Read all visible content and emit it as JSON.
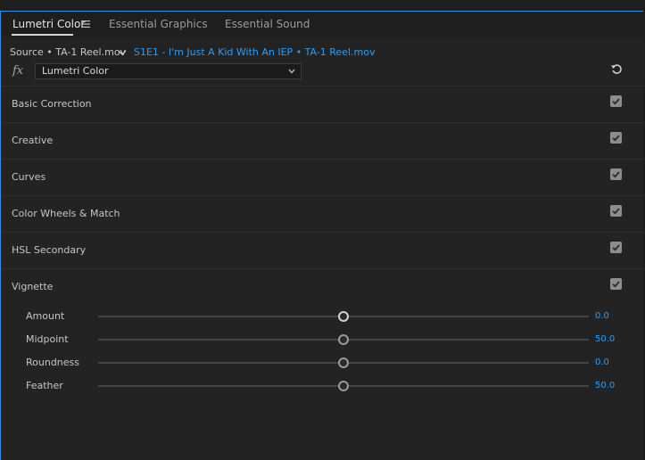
{
  "tabs": [
    {
      "label": "Lumetri Color"
    },
    {
      "label": "Essential Graphics"
    },
    {
      "label": "Essential Sound"
    }
  ],
  "source": {
    "clip_label": "Source • TA-1 Reel.mov",
    "sequence_label": "S1E1 - I'm Just A Kid With An IEP • TA-1 Reel.mov"
  },
  "effect": {
    "fx_label": "fx",
    "selected": "Lumetri Color"
  },
  "sections": [
    {
      "title": "Basic Correction",
      "enabled": true
    },
    {
      "title": "Creative",
      "enabled": true
    },
    {
      "title": "Curves",
      "enabled": true
    },
    {
      "title": "Color Wheels & Match",
      "enabled": true
    },
    {
      "title": "HSL Secondary",
      "enabled": true
    },
    {
      "title": "Vignette",
      "enabled": true
    }
  ],
  "vignette": {
    "amount": {
      "label": "Amount",
      "value": "0.0",
      "position": 0.5
    },
    "midpoint": {
      "label": "Midpoint",
      "value": "50.0",
      "position": 0.5
    },
    "roundness": {
      "label": "Roundness",
      "value": "0.0",
      "position": 0.5
    },
    "feather": {
      "label": "Feather",
      "value": "50.0",
      "position": 0.5
    }
  },
  "colors": {
    "accent": "#2d9cf5",
    "panel_border": "#2d8ceb",
    "background": "#232323"
  }
}
